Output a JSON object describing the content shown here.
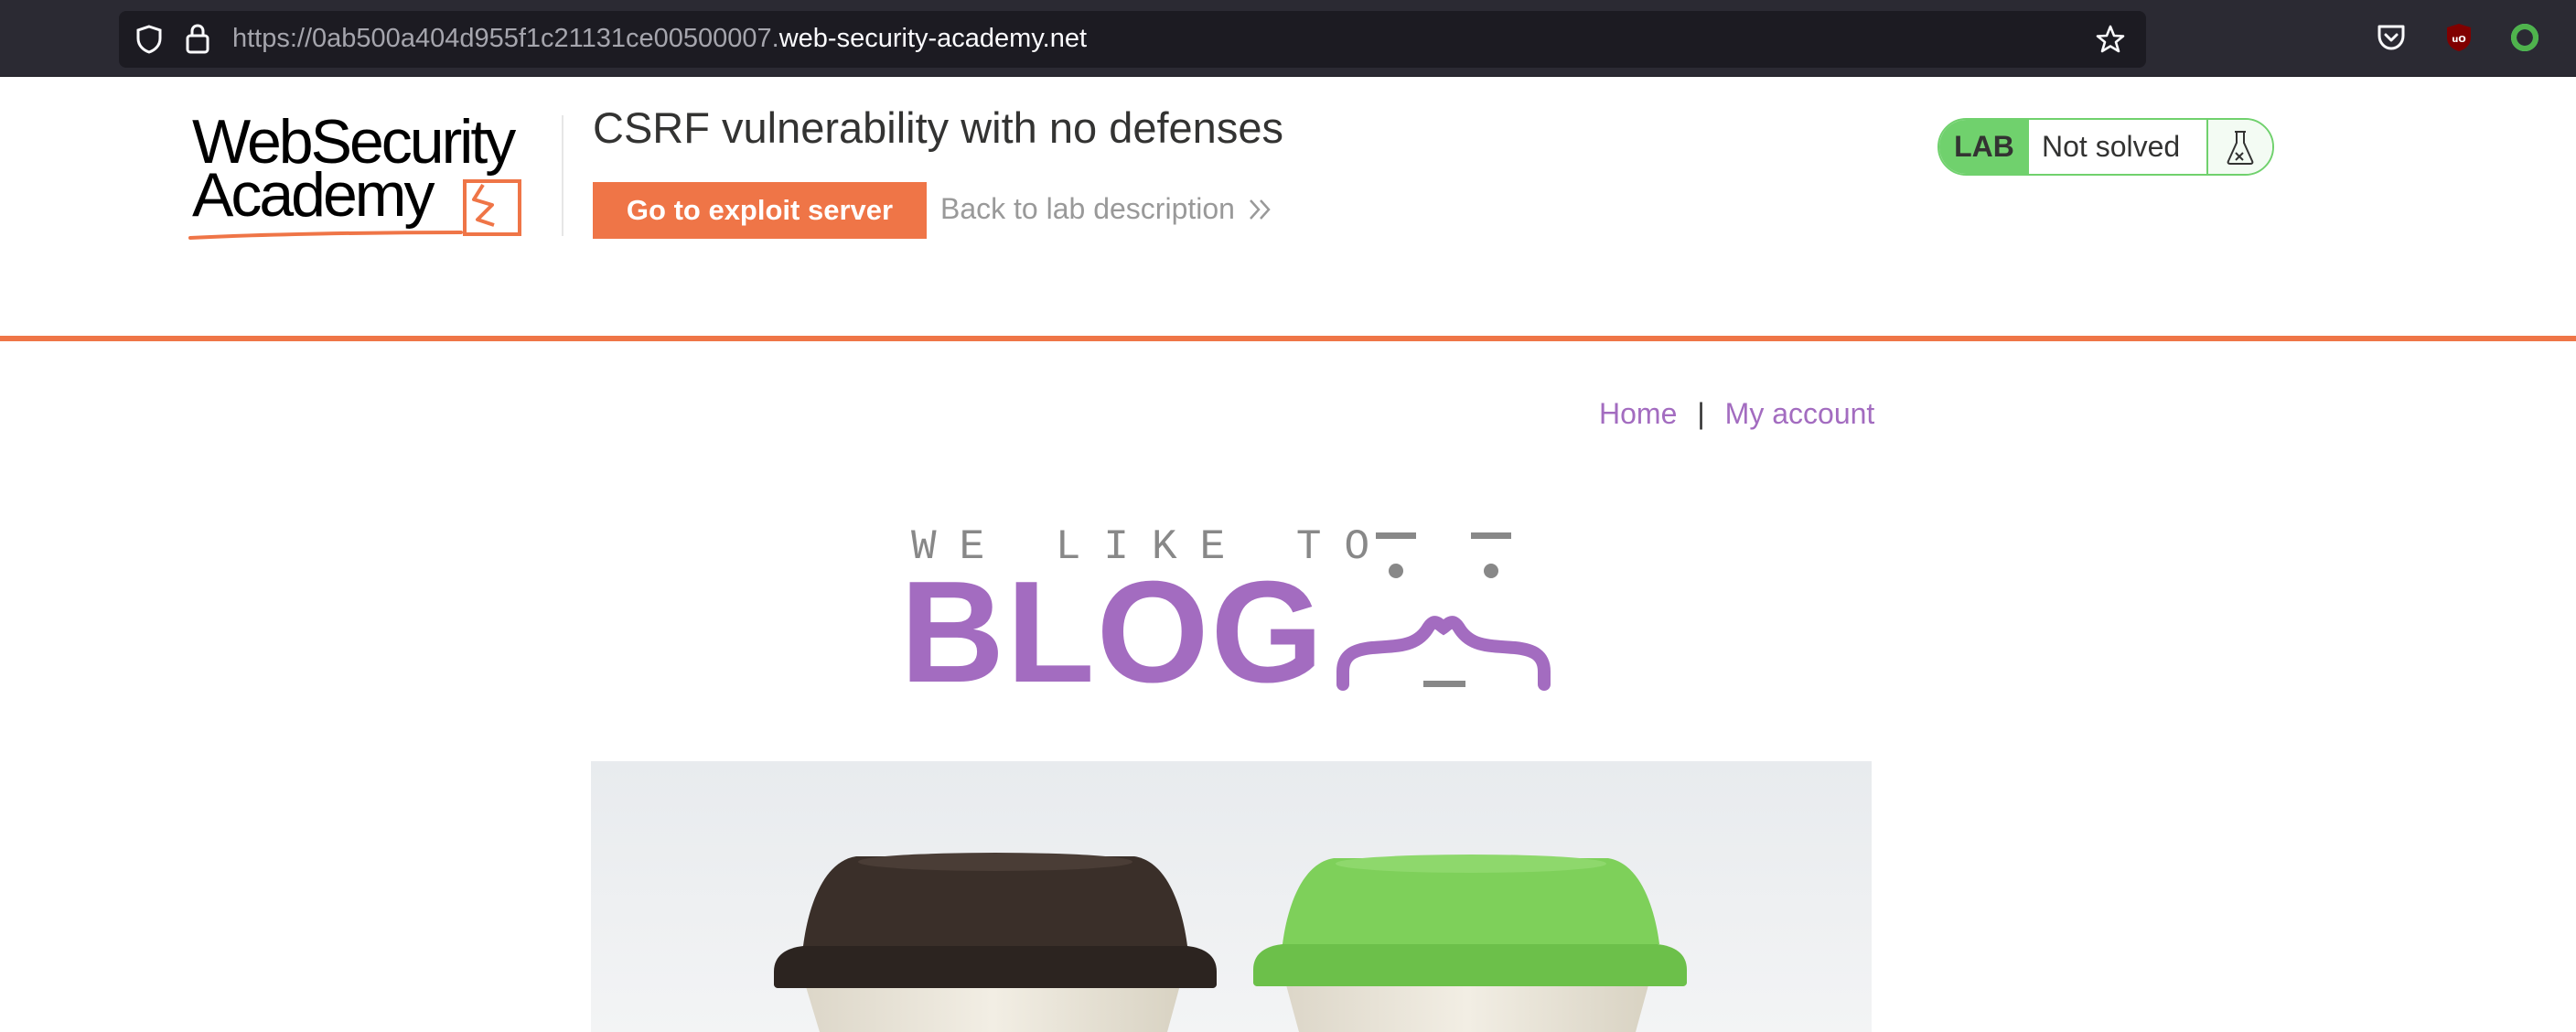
{
  "browser": {
    "url_prefix": "https://0ab500a404d955f1c21131ce00500007.",
    "url_domain": "web-security-academy.net",
    "icons": [
      "shield-icon",
      "lock-icon",
      "star-icon",
      "pocket-icon",
      "ublock-icon",
      "extension-icon"
    ]
  },
  "lab_header": {
    "logo_line1": "WebSecurity",
    "logo_line2": "Academy",
    "title": "CSRF vulnerability with no defenses",
    "exploit_button": "Go to exploit server",
    "back_link": "Back to lab description",
    "status_badge": "LAB",
    "status_text": "Not solved",
    "colors": {
      "accent": "#ef7547",
      "solved_green": "#70d16d"
    }
  },
  "nav": {
    "home": "Home",
    "separator": "|",
    "my_account": "My account",
    "link_color": "#a36cc0"
  },
  "blog_logo": {
    "tagline": "WE LIKE TO",
    "word": "BLOG",
    "brand_color": "#a36cc0"
  },
  "hero": {
    "icon": "coffee-cups-image"
  }
}
